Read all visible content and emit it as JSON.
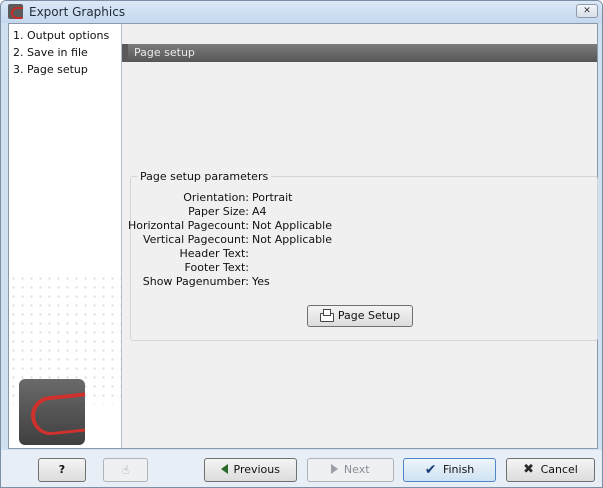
{
  "window": {
    "title": "Export Graphics",
    "close_glyph": "✕"
  },
  "sidebar": {
    "steps": [
      {
        "label": "1. Output options"
      },
      {
        "label": "2. Save in file"
      },
      {
        "label": "3. Page setup"
      }
    ]
  },
  "page": {
    "header": "Page setup"
  },
  "params": {
    "group_title": "Page setup parameters",
    "rows": [
      {
        "label": "Orientation:",
        "value": "Portrait"
      },
      {
        "label": "Paper Size:",
        "value": "A4"
      },
      {
        "label": "Horizontal Pagecount:",
        "value": "Not Applicable"
      },
      {
        "label": "Vertical Pagecount:",
        "value": "Not Applicable"
      },
      {
        "label": "Header Text:",
        "value": ""
      },
      {
        "label": "Footer Text:",
        "value": ""
      },
      {
        "label": "Show Pagenumber:",
        "value": "Yes"
      }
    ],
    "page_setup_button": "Page Setup"
  },
  "footer": {
    "help": "?",
    "previous": "Previous",
    "next": "Next",
    "finish": "Finish",
    "cancel": "Cancel"
  },
  "colors": {
    "header_bar": "#666666",
    "accent_finish": "#4e86c7",
    "logo_red": "#d0312d"
  },
  "icons": [
    "app-icon",
    "close-icon",
    "printer-icon",
    "help-icon",
    "hand-icon",
    "previous-arrow-icon",
    "next-arrow-icon",
    "finish-check-icon",
    "cancel-x-icon"
  ]
}
